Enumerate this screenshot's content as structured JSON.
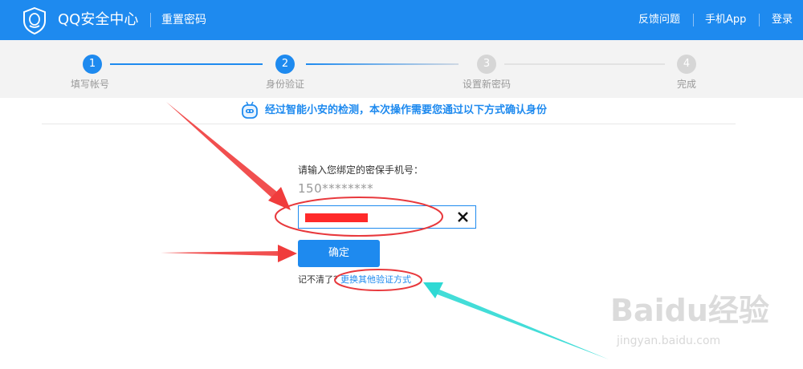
{
  "header": {
    "brand": "QQ安全中心",
    "subtitle": "重置密码",
    "nav": [
      "反馈问题",
      "手机App",
      "登录"
    ],
    "color": "#1e8aef"
  },
  "stepper": {
    "steps": [
      {
        "num": "1",
        "label": "填写帐号",
        "state": "done"
      },
      {
        "num": "2",
        "label": "身份验证",
        "state": "active"
      },
      {
        "num": "3",
        "label": "设置新密码",
        "state": "pending"
      },
      {
        "num": "4",
        "label": "完成",
        "state": "pending"
      }
    ]
  },
  "notice": {
    "text": "经过智能小安的检测，本次操作需要您通过以下方式确认身份",
    "icon": "robot-icon"
  },
  "form": {
    "prompt": "请输入您绑定的密保手机号：",
    "masked_phone": "150********",
    "input_value_redacted": true,
    "clear_icon": "close-icon",
    "confirm_label": "确定",
    "forgot_text": "记不清了？",
    "other_method_link": "更换其他验证方式"
  },
  "annotations": {
    "arrow_color_red": "#f03c3c",
    "arrow_color_cyan": "#2fd9d4",
    "ellipse_color": "#e8393d"
  },
  "watermark": {
    "brand": "Baidu经验",
    "url": "jingyan.baidu.com"
  }
}
